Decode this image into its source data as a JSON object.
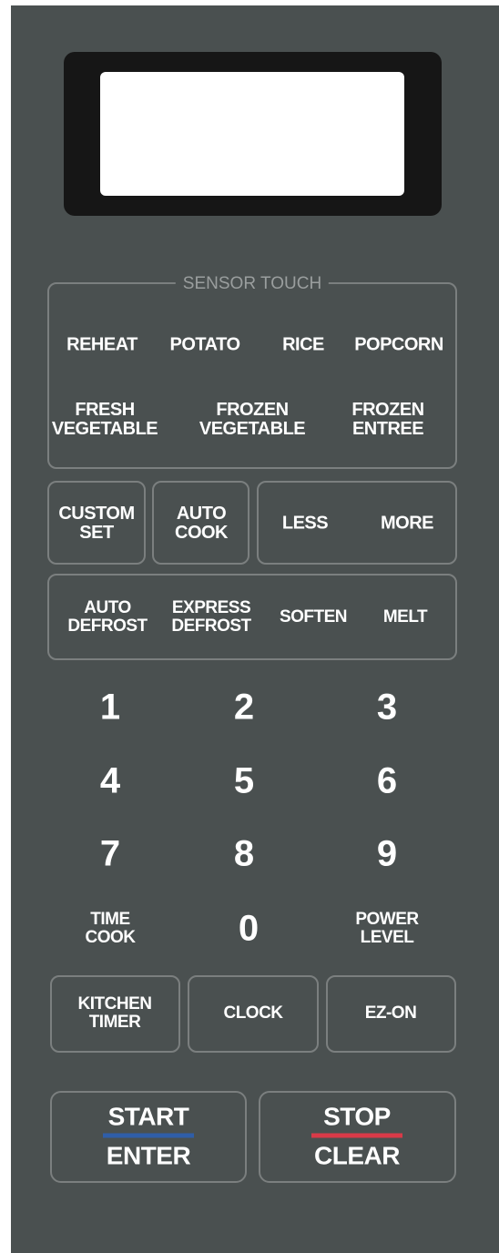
{
  "display": {
    "value": ""
  },
  "sensor": {
    "title": "SENSOR TOUCH",
    "reheat": "REHEAT",
    "potato": "POTATO",
    "rice": "RICE",
    "popcorn": "POPCORN",
    "fresh_vegetable": [
      "FRESH",
      "VEGETABLE"
    ],
    "frozen_vegetable": [
      "FROZEN",
      "VEGETABLE"
    ],
    "frozen_entree": [
      "FROZEN",
      "ENTREE"
    ]
  },
  "row2": {
    "custom_set": [
      "CUSTOM",
      "SET"
    ],
    "auto_cook": [
      "AUTO",
      "COOK"
    ],
    "less": "LESS",
    "more": "MORE"
  },
  "row3": {
    "auto_defrost": [
      "AUTO",
      "DEFROST"
    ],
    "express_defrost": [
      "EXPRESS",
      "DEFROST"
    ],
    "soften": "SOFTEN",
    "melt": "MELT"
  },
  "keypad": {
    "n1": "1",
    "n2": "2",
    "n3": "3",
    "n4": "4",
    "n5": "5",
    "n6": "6",
    "n7": "7",
    "n8": "8",
    "n9": "9",
    "time_cook": [
      "TIME",
      "COOK"
    ],
    "n0": "0",
    "power_level": [
      "POWER",
      "LEVEL"
    ]
  },
  "bottom": {
    "kitchen_timer": [
      "KITCHEN",
      "TIMER"
    ],
    "clock": "CLOCK",
    "ez_on": "EZ-ON"
  },
  "start": {
    "top": "START",
    "bottom": "ENTER",
    "bar_color": "#2f5ea8"
  },
  "stop": {
    "top": "STOP",
    "bottom": "CLEAR",
    "bar_color": "#d83a48"
  },
  "colors": {
    "panel": "#4a5050",
    "bezel": "#161616",
    "outline": "#7b7f7f",
    "label": "#ffffff",
    "sensor_title": "#9a9e9e"
  }
}
